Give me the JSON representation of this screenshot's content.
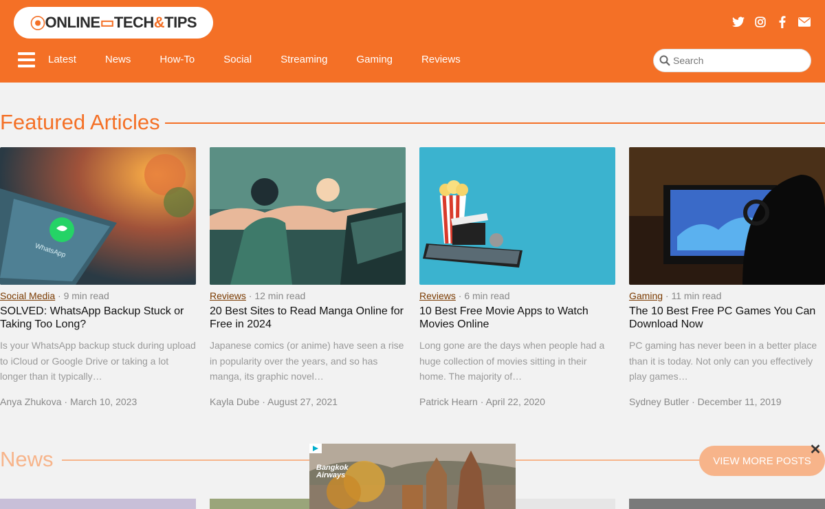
{
  "header": {
    "logo_online": "ONLINE",
    "logo_tech": "TECH",
    "logo_tips": "TIPS",
    "social_icons": [
      "twitter-icon",
      "instagram-icon",
      "facebook-icon",
      "mail-icon"
    ],
    "nav": [
      "Latest",
      "News",
      "How-To",
      "Social",
      "Streaming",
      "Gaming",
      "Reviews"
    ],
    "search_placeholder": "Search"
  },
  "featured": {
    "heading": "Featured Articles",
    "articles": [
      {
        "category": "Social Media",
        "read_time": "· 9 min read",
        "title": "SOLVED: WhatsApp Backup Stuck or Taking Too Long?",
        "excerpt": "Is your WhatsApp backup stuck during upload to iCloud or Google Drive or taking a lot longer than it typically…",
        "author": "Anya Zhukova",
        "date": "· March 10, 2023",
        "image_text": "WhatsApp"
      },
      {
        "category": "Reviews",
        "read_time": "· 12 min read",
        "title": "20 Best Sites to Read Manga Online for Free in 2024",
        "excerpt": "Japanese comics (or anime) have seen a rise in popularity over the years, and so has manga, its graphic novel…",
        "author": "Kayla Dube",
        "date": "· August 27, 2021"
      },
      {
        "category": "Reviews",
        "read_time": "· 6 min read",
        "title": "10 Best Free Movie Apps to Watch Movies Online",
        "excerpt": "Long gone are the days when people had a huge collection of movies sitting in their home. The majority of…",
        "author": "Patrick Hearn",
        "date": "· April 22, 2020"
      },
      {
        "category": "Gaming",
        "read_time": "· 11 min read",
        "title": "The 10 Best Free PC Games You Can Download Now",
        "excerpt": "PC gaming has never been in a better place than it is today. Not only can you effectively play games…",
        "author": "Sydney Butler",
        "date": "· December 11, 2019"
      }
    ]
  },
  "news": {
    "heading": "News",
    "view_more": "VIEW MORE POSTS"
  },
  "ad": {
    "brand_line1": "Bangkok",
    "brand_line2": "Airways",
    "close_glyph": "✕"
  }
}
